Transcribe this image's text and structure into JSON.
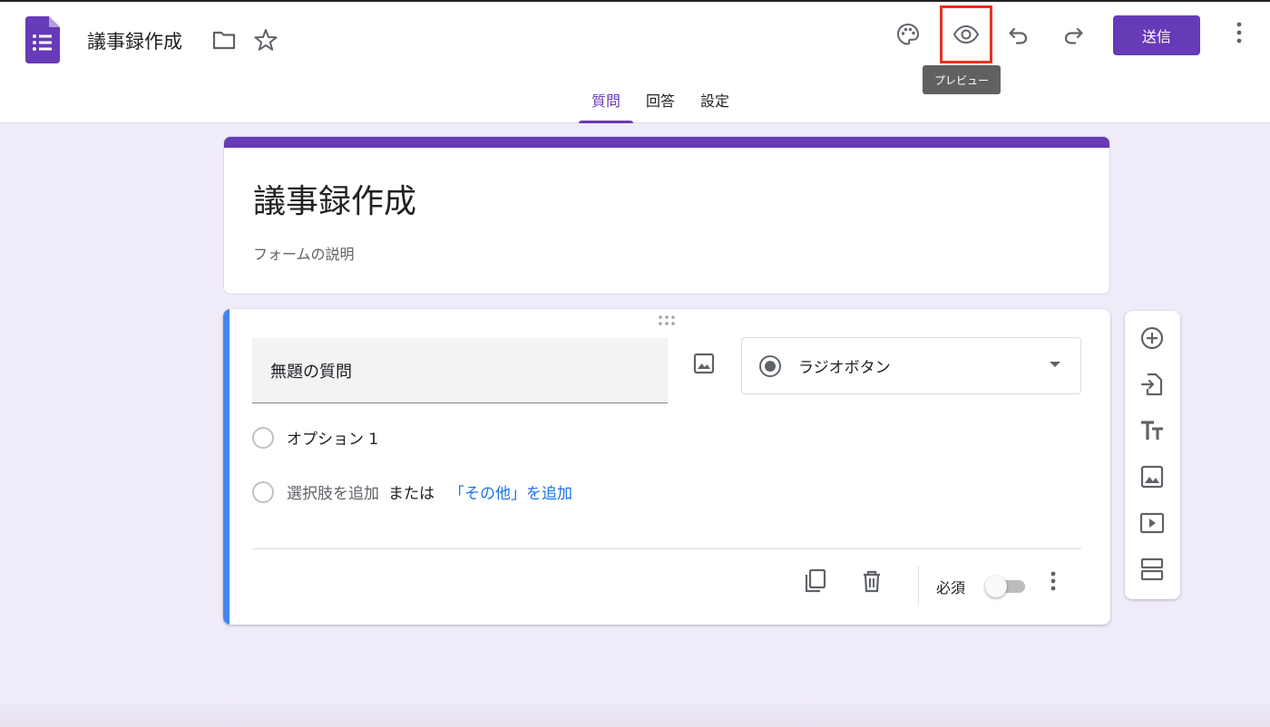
{
  "header": {
    "doc_title": "議事録作成",
    "send_label": "送信",
    "tooltip": "プレビュー",
    "accent_color": "#673ab7",
    "highlight_color": "#e8311a"
  },
  "tabs": [
    {
      "label": "質問",
      "active": true
    },
    {
      "label": "回答",
      "active": false
    },
    {
      "label": "設定",
      "active": false
    }
  ],
  "form": {
    "title": "議事録作成",
    "description_placeholder": "フォームの説明"
  },
  "question": {
    "title": "無題の質問",
    "type": "ラジオボタン",
    "options": [
      "オプション 1"
    ],
    "add_option": "選択肢を追加",
    "or_text": "または",
    "add_other": "「その他」を追加",
    "required_label": "必須",
    "required": false
  },
  "side_toolbar": {
    "icons": [
      "add-question-icon",
      "import-questions-icon",
      "add-title-icon",
      "add-image-icon",
      "add-video-icon",
      "add-section-icon"
    ]
  }
}
